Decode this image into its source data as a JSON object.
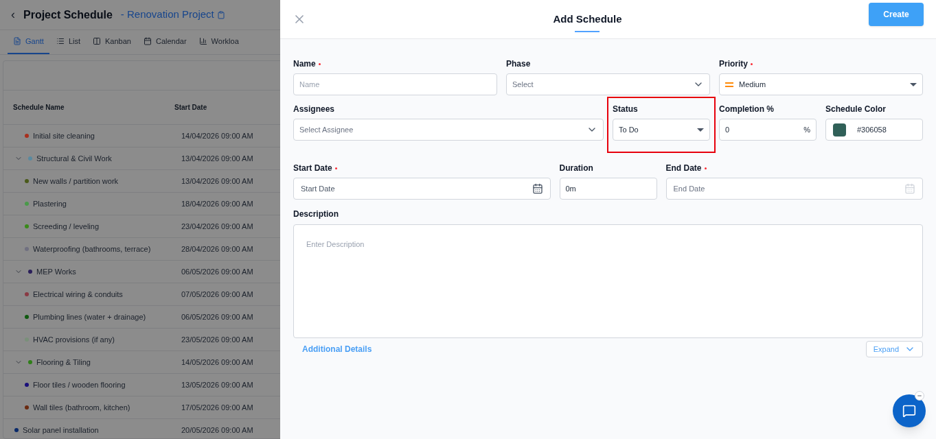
{
  "page": {
    "back_label": "‹",
    "title": "Project Schedule",
    "project": "- Renovation Project",
    "tabs": [
      {
        "label": "Gantt",
        "selected": true
      },
      {
        "label": "List",
        "selected": false
      },
      {
        "label": "Kanban",
        "selected": false
      },
      {
        "label": "Calendar",
        "selected": false
      },
      {
        "label": "Workloa",
        "selected": false
      }
    ],
    "table": {
      "columns": [
        "Schedule Name",
        "Start Date"
      ],
      "rows": [
        {
          "children": [
            {
              "name": "Initial site cleaning",
              "start": "14/04/2026 09:00 AM",
              "color": "#a8301e"
            }
          ]
        },
        {
          "name": "Structural & Civil Work",
          "start": "13/04/2026 09:00 AM",
          "color": "#5a8aa0",
          "expanded": true,
          "children": [
            {
              "name": "New walls / partition work",
              "start": "13/04/2026 09:00 AM",
              "color": "#4a5a1a"
            },
            {
              "name": "Plastering",
              "start": "18/04/2026 09:00 AM",
              "color": "#4a9a4a"
            },
            {
              "name": "Screeding / leveling",
              "start": "23/04/2026 09:00 AM",
              "color": "#3a8a1a"
            },
            {
              "name": "Waterproofing (bathrooms, terrace)",
              "start": "28/04/2026 09:00 AM",
              "color": "#707080"
            }
          ]
        },
        {
          "name": "MEP Works",
          "start": "06/05/2026 09:00 AM",
          "color": "#2a1f5a",
          "expanded": true,
          "children": [
            {
              "name": "Electrical wiring & conduits",
              "start": "07/05/2026 09:00 AM",
              "color": "#8a3a44"
            },
            {
              "name": "Plumbing lines (water + drainage)",
              "start": "06/05/2026 09:00 AM",
              "color": "#105a10"
            },
            {
              "name": "HVAC provisions (if any)",
              "start": "23/05/2026 09:00 AM",
              "color": "#7a907a"
            }
          ]
        },
        {
          "name": "Flooring & Tiling",
          "start": "14/05/2026 09:00 AM",
          "color": "#2f7f18",
          "expanded": true,
          "children": [
            {
              "name": "Floor tiles / wooden flooring",
              "start": "13/05/2026 09:00 AM",
              "color": "#1a0f7a"
            },
            {
              "name": "Wall tiles (bathroom, kitchen)",
              "start": "17/05/2026 09:00 AM",
              "color": "#6a2a10"
            }
          ]
        },
        {
          "name": "Solar panel installation",
          "start": "20/05/2026 09:00 AM",
          "color": "#0a2a6a"
        }
      ]
    }
  },
  "drawer": {
    "title": "Add Schedule",
    "create_button": "Create",
    "rows": [
      [
        {
          "kind": "text",
          "label": "Name",
          "required": true,
          "placeholder": "Name"
        },
        {
          "kind": "select",
          "label": "Phase",
          "required": false,
          "placeholder": "Select"
        },
        {
          "kind": "priority",
          "label": "Priority",
          "required": true,
          "value": "Medium"
        }
      ],
      [
        {
          "kind": "select",
          "label": "Assignees",
          "required": false,
          "placeholder": "Select Assignee"
        },
        {
          "kind": "dropdown",
          "label": "Status",
          "required": false,
          "value": "To Do",
          "highlighted": true
        },
        {
          "kind": "percent",
          "label": "Completion %",
          "required": false,
          "value": "0",
          "suffix": "%"
        },
        {
          "kind": "color",
          "label": "Schedule Color",
          "required": false,
          "value": "#306058"
        }
      ]
    ],
    "date_row": [
      {
        "kind": "date",
        "label": "Start Date",
        "required": true,
        "placeholder": "Start Date",
        "disabled": false
      },
      {
        "kind": "text",
        "label": "Duration",
        "required": false,
        "value": "0m"
      },
      {
        "kind": "date",
        "label": "End Date",
        "required": true,
        "placeholder": "End Date",
        "disabled": true
      }
    ],
    "description": {
      "label": "Description",
      "placeholder": "Enter Description"
    },
    "additional_details": "Additional Details",
    "expand_button": "Expand"
  }
}
